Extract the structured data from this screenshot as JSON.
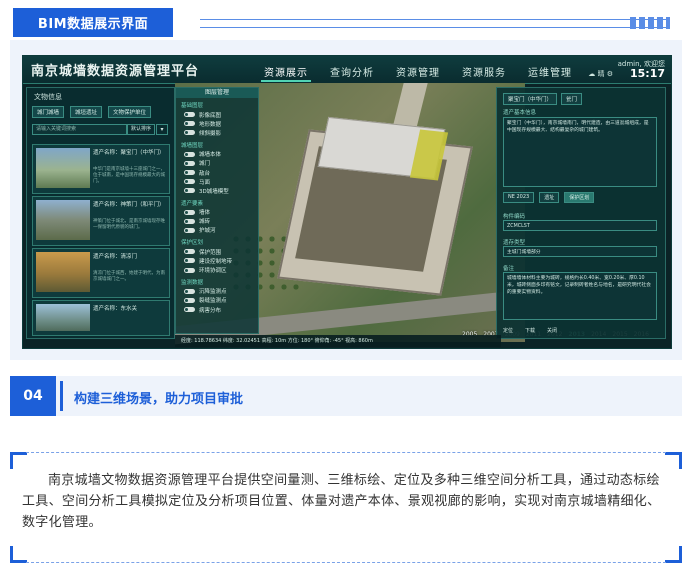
{
  "top_tag": "BIM数据展示界面",
  "app": {
    "title": "南京城墙数据资源管理平台",
    "nav": [
      "资源展示",
      "查询分析",
      "资源管理",
      "资源服务",
      "运维管理"
    ],
    "user": "admin, 欢迎您",
    "time": "15:17",
    "weather": "晴"
  },
  "left_panel": {
    "title": "文物信息",
    "tabs": [
      "城门城墙",
      "城垣遗址",
      "文物保护单位"
    ],
    "search_placeholder": "请输入关键词搜索",
    "sort_label": "默认排序",
    "cards": [
      {
        "title": "遗产名称：聚宝门（中华门）",
        "desc": "中华门是南京城墙十三座城门之一，位于城南，是中国现存规模最大的城门。"
      },
      {
        "title": "遗产名称：神策门（和平门）",
        "desc": "神策门位于城北，是南京城墙现存唯一保留明代原貌的城门。"
      },
      {
        "title": "遗产名称：清凉门",
        "desc": "清凉门位于城西，始建于明代，为南京城墙城门之一。"
      },
      {
        "title": "遗产名称：东水关",
        "desc": "东水关位于秦淮河入城口，是南京城墙水关遗址。"
      }
    ]
  },
  "layer_panel": {
    "title": "图层管理",
    "sections": [
      {
        "name": "基础图层",
        "items": [
          "影像底图",
          "地形数据",
          "倾斜摄影"
        ]
      },
      {
        "name": "城墙图层",
        "items": [
          "城墙本体",
          "城门",
          "敌台",
          "马面",
          "3D城墙模型"
        ]
      },
      {
        "name": "遗产要素",
        "items": [
          "墙体",
          "城砖",
          "护城河"
        ]
      },
      {
        "name": "保护区划",
        "items": [
          "保护范围",
          "建设控制地带",
          "环境协调区"
        ]
      },
      {
        "name": "监测数据",
        "items": [
          "沉降监测点",
          "裂缝监测点",
          "病害分布"
        ]
      }
    ]
  },
  "timeline": {
    "years": [
      "2005",
      "2007",
      "2009",
      "2011",
      "2012",
      "2013",
      "2014",
      "2015",
      "2016"
    ],
    "active": "2013"
  },
  "right_panel": {
    "breadcrumb": [
      "聚宝门（中华门）",
      "瓮门"
    ],
    "label_intro": "遗产基本信息",
    "intro": "聚宝门（中华门），南京城墙南门，明代建造，由三道瓮城组成，是中国现存规模最大、结构最复杂的城门建筑。",
    "chips": [
      "NE 2023",
      "遗址",
      "保护区划"
    ],
    "chips_active": "保护区划",
    "label_code": "构件编码",
    "code": "ZCMCLST",
    "label_type": "遗存类型",
    "type": "主城门城墙部分",
    "label_note": "备注",
    "note": "城墙墙体材料主要为城砖，规格约长0.40米、宽0.20米、厚0.10米，城砖侧面多印有铭文，记录制砖者姓名与地名，是研究明代社会的重要实物资料。",
    "actions": [
      "定位",
      "下载",
      "关闭"
    ]
  },
  "status_bar": "经度: 118.78634  纬度: 32.02451  高程: 10m  方位: 180°  俯仰角: -45°  视高: 860m",
  "section": {
    "number": "04",
    "title": "构建三维场景，助力项目审批"
  },
  "body_text": "南京城墙文物数据资源管理平台提供空间量测、三维标绘、定位及多种三维空间分析工具，通过动态标绘工具、空间分析工具模拟定位及分析项目位置、体量对遗产本体、景观视廊的影响，实现对南京城墙精细化、数字化管理。"
}
